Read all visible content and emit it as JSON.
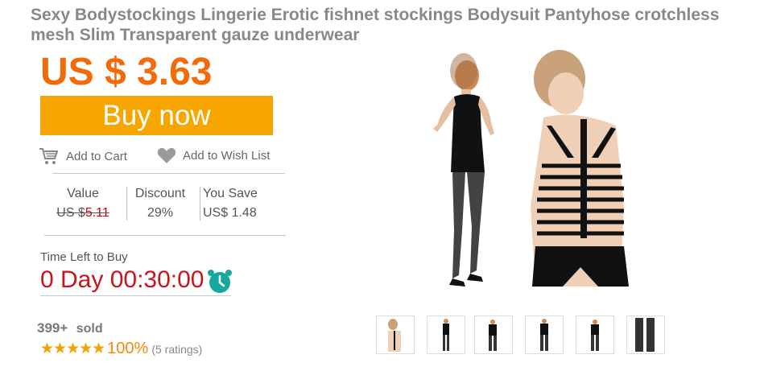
{
  "product": {
    "title": "Sexy Bodystockings Lingerie Erotic fishnet stockings Bodysuit Pantyhose crotchless mesh Slim Transparent gauze underwear",
    "price": "US $ 3.63"
  },
  "actions": {
    "buy_now": "Buy now",
    "add_to_cart": "Add to Cart",
    "add_to_wishlist": "Add to Wish List"
  },
  "pricing": {
    "value_header": "Value",
    "value_prefix": "US $",
    "value_amount": "5.11",
    "discount_header": "Discount",
    "discount": "29%",
    "save_header": "You Save",
    "save": "US$ 1.48"
  },
  "timer": {
    "label": "Time Left to Buy",
    "countdown": "0 Day 00:30:00"
  },
  "sales": {
    "count": "399+",
    "label": "sold",
    "stars": "★★★★★",
    "rating_percent": "100%",
    "ratings_count": "(5 ratings)"
  },
  "colors": {
    "price": "#f26b0b",
    "buy_button": "#f7a600",
    "countdown": "#c8141e",
    "alarm": "#17a9a0",
    "stars": "#f3a000"
  },
  "icons": [
    "cart-icon",
    "heart-icon",
    "alarm-clock-icon"
  ],
  "gallery": {
    "thumbnail_count": 6
  }
}
